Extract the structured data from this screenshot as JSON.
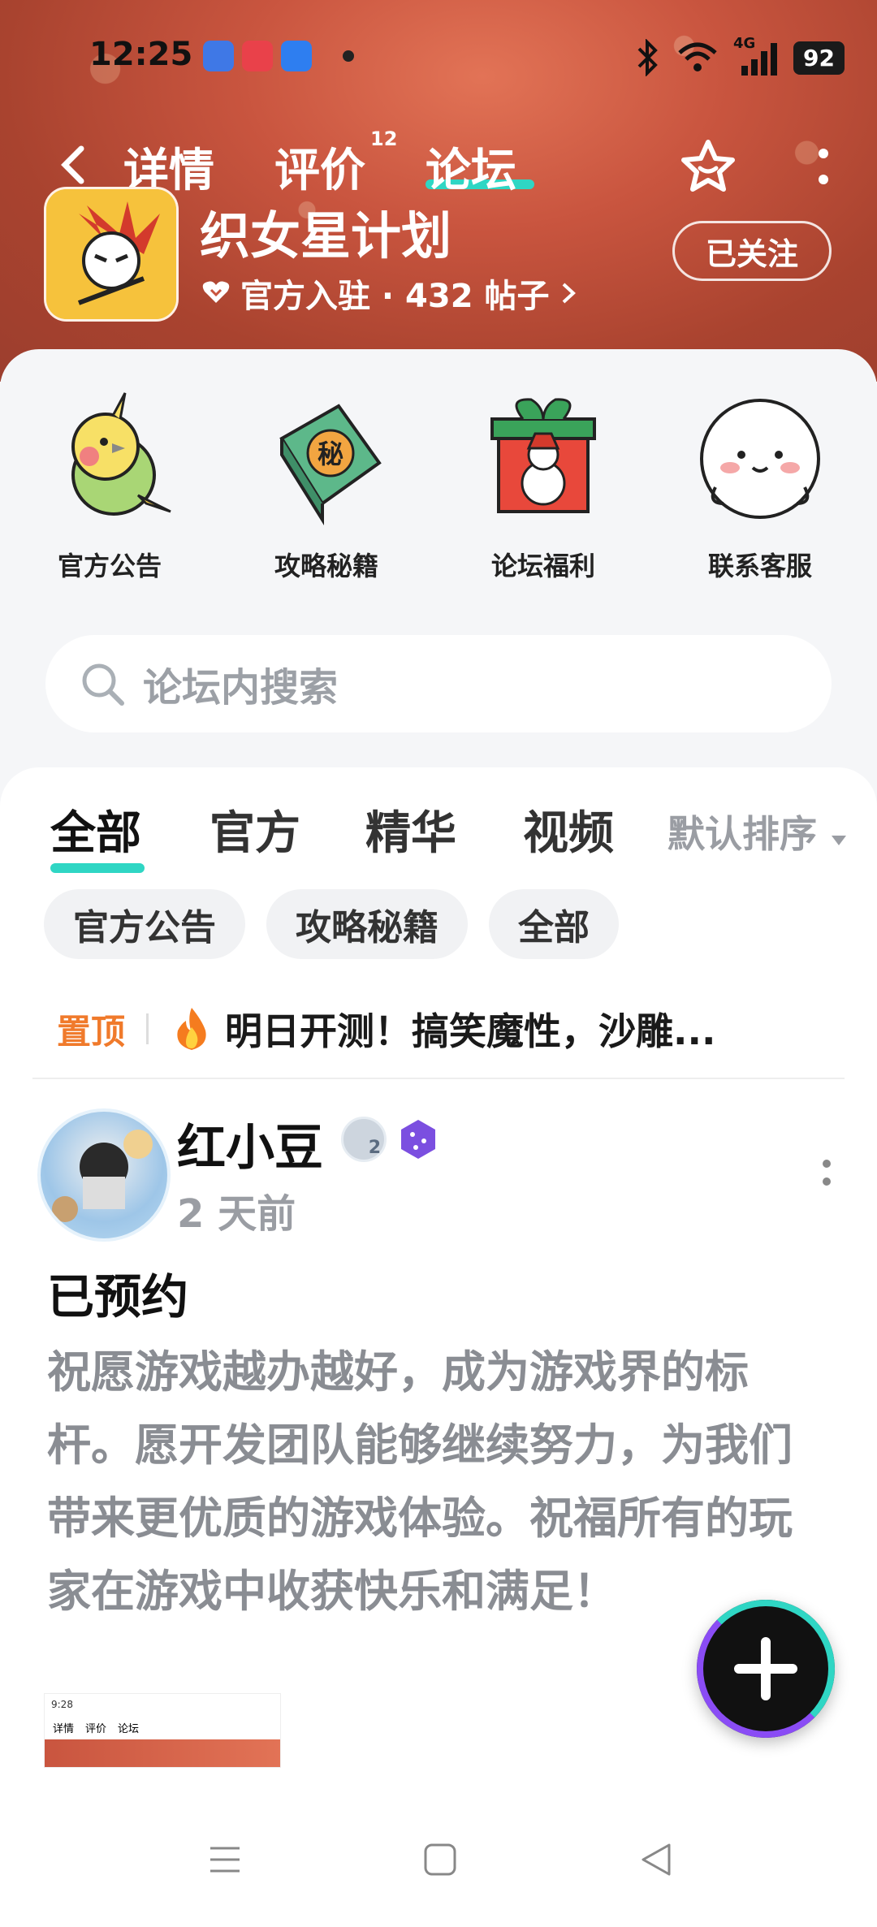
{
  "status": {
    "time": "12:25",
    "battery": "92",
    "network": "4G"
  },
  "nav": {
    "tabs": [
      {
        "label": "详情"
      },
      {
        "label": "评价",
        "badge": "12"
      },
      {
        "label": "论坛"
      }
    ]
  },
  "app": {
    "name": "织女星计划",
    "meta": "官方入驻 · 432 帖子",
    "follow_label": "已关注"
  },
  "quick": [
    {
      "label": "官方公告",
      "icon": "parrot-icon"
    },
    {
      "label": "攻略秘籍",
      "icon": "secret-book-icon"
    },
    {
      "label": "论坛福利",
      "icon": "gift-box-icon"
    },
    {
      "label": "联系客服",
      "icon": "smiling-mascot-icon"
    }
  ],
  "search": {
    "placeholder": "论坛内搜索"
  },
  "filter": {
    "tabs": [
      "全部",
      "官方",
      "精华",
      "视频"
    ],
    "sort": "默认排序"
  },
  "chips": [
    "官方公告",
    "攻略秘籍",
    "全部"
  ],
  "pinned": {
    "tag": "置顶",
    "title": "明日开测！搞笑魔性，沙雕..."
  },
  "post": {
    "author": "红小豆",
    "level": "2",
    "time": "2 天前",
    "title": "已预约",
    "body": "祝愿游戏越办越好，成为游戏界的标杆。愿开发团队能够继续努力，为我们带来更优质的游戏体验。祝福所有的玩家在游戏中收获快乐和满足！",
    "thumb": {
      "time": "9:28",
      "tabs": [
        "详情",
        "评价",
        "论坛"
      ]
    }
  },
  "colors": {
    "accent": "#2fd6c4",
    "pinned": "#f07a2b",
    "header": "#c9553f"
  }
}
